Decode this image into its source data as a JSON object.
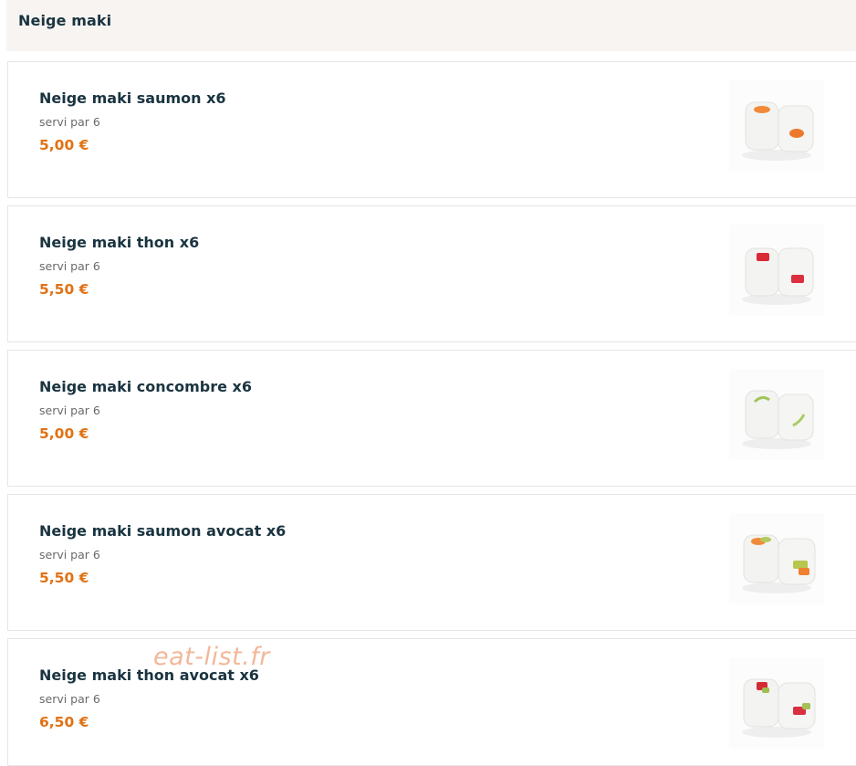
{
  "section": {
    "title": "Neige maki"
  },
  "colors": {
    "title": "#1a3440",
    "price": "#e07214",
    "header_bg": "#f7f4f1",
    "watermark": "#e88c5a"
  },
  "items": [
    {
      "name": "Neige maki saumon x6",
      "serving": "servi par 6",
      "price": "5,00 €",
      "image": "maki-saumon-photo",
      "fillings": [
        "salmon",
        "salmon"
      ]
    },
    {
      "name": "Neige maki thon x6",
      "serving": "servi par 6",
      "price": "5,50 €",
      "image": "maki-thon-photo",
      "fillings": [
        "tuna",
        "tuna"
      ]
    },
    {
      "name": "Neige maki concombre x6",
      "serving": "servi par 6",
      "price": "5,00 €",
      "image": "maki-concombre-photo",
      "fillings": [
        "cucumber",
        "cucumber"
      ]
    },
    {
      "name": "Neige maki saumon avocat x6",
      "serving": "servi par 6",
      "price": "5,50 €",
      "image": "maki-saumon-avocat-photo",
      "fillings": [
        "salmon-avocado",
        "salmon-avocado"
      ]
    },
    {
      "name": "Neige maki thon avocat x6",
      "serving": "servi par 6",
      "price": "6,50 €",
      "image": "maki-thon-avocat-photo",
      "fillings": [
        "tuna-avocado",
        "tuna-avocado"
      ]
    }
  ],
  "watermark": {
    "text": "eat-list.fr"
  }
}
